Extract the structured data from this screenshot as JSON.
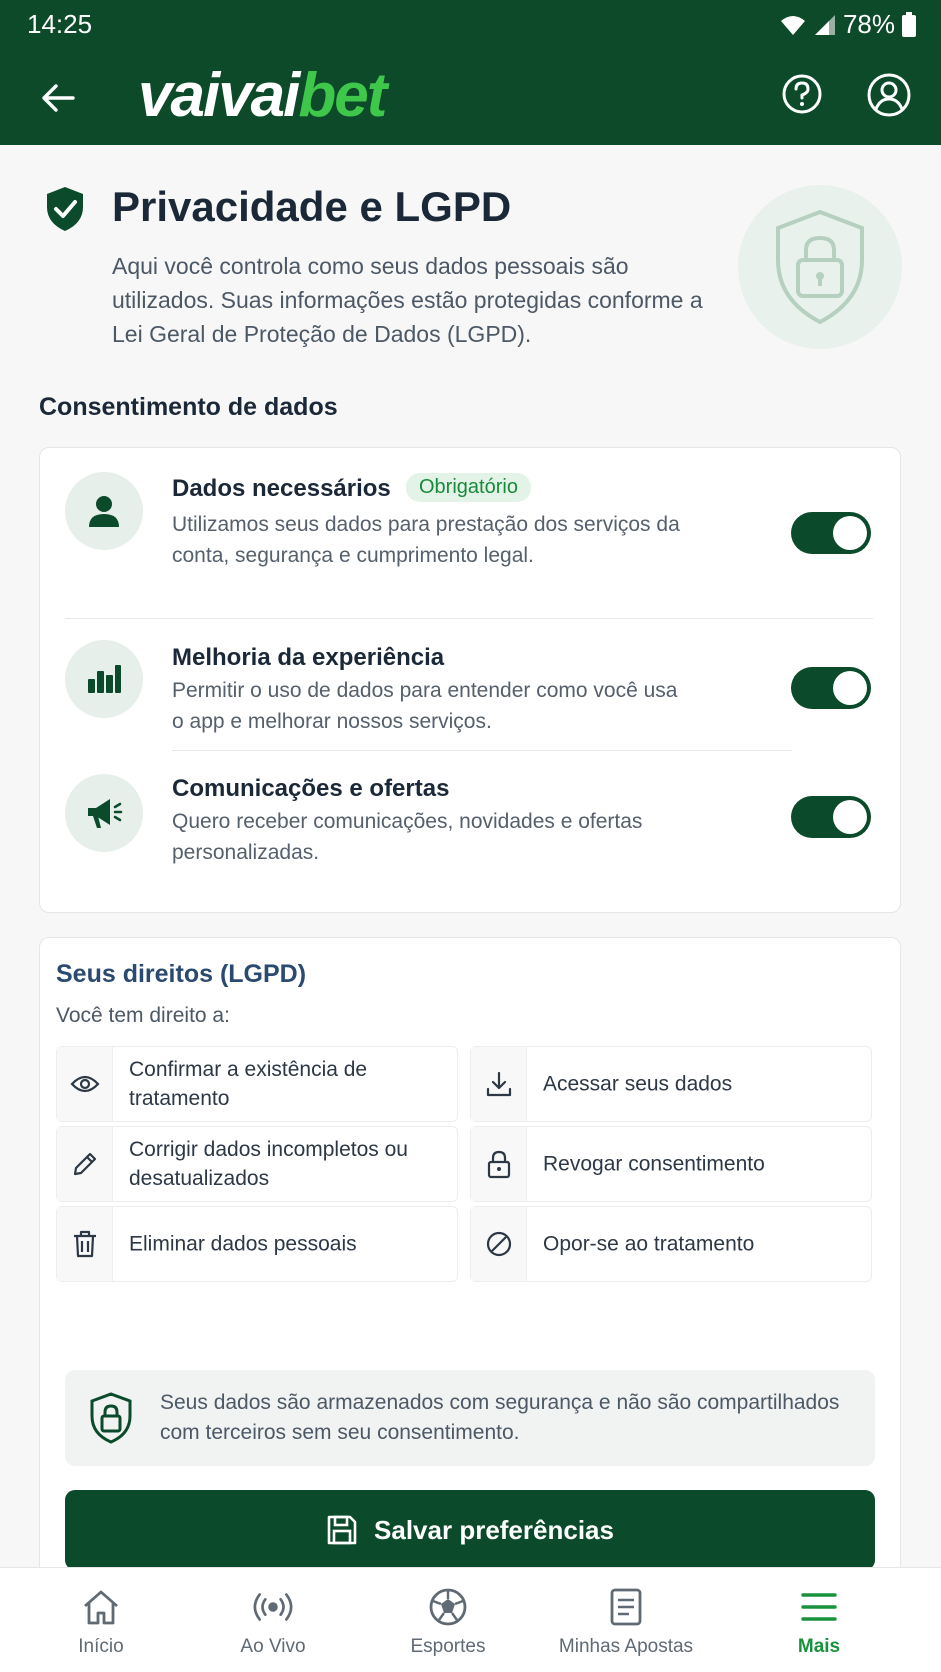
{
  "status_bar": {
    "time": "14:25",
    "battery": "78%"
  },
  "header": {
    "logo_part1": "vaivai",
    "logo_part2": "bet",
    "icons": [
      "arrow-left-icon",
      "help-circle-icon",
      "user-circle-icon"
    ]
  },
  "intro": {
    "title": "Privacidade e LGPD",
    "text": "Aqui você controla como seus dados pessoais são utilizados. Suas informações estão protegidas conforme a Lei Geral de Proteção de Dados (LGPD)."
  },
  "consent": {
    "section_title": "Consentimento de dados",
    "items": [
      {
        "title": "Dados necessários",
        "badge": "Obrigatório",
        "description": "Utilizamos seus dados para prestação dos serviços da conta, segurança e cumprimento legal.",
        "enabled": true,
        "icon": "user-icon"
      },
      {
        "title": "Melhoria da experiência",
        "description": "Permitir o uso de dados para entender como você usa o app e melhorar nossos serviços.",
        "enabled": true,
        "icon": "bar-chart-icon"
      },
      {
        "title": "Comunicações e ofertas",
        "description": "Quero receber comunicações, novidades e ofertas personalizadas.",
        "enabled": true,
        "icon": "megaphone-icon"
      }
    ]
  },
  "rights": {
    "title": "Seus direitos (LGPD)",
    "subtitle": "Você tem direito a:",
    "items": [
      {
        "label": "Confirmar a existência de tratamento",
        "icon": "eye-icon"
      },
      {
        "label": "Acessar seus dados",
        "icon": "download-icon"
      },
      {
        "label": "Corrigir dados incompletos ou desatualizados",
        "icon": "pencil-icon"
      },
      {
        "label": "Revogar consentimento",
        "icon": "lock-icon"
      },
      {
        "label": "Eliminar dados pessoais",
        "icon": "trash-icon"
      },
      {
        "label": "Opor-se ao tratamento",
        "icon": "block-icon"
      }
    ]
  },
  "note": {
    "text": "Seus dados são armazenados com segurança e não são compartilhados com terceiros sem seu consentimento."
  },
  "save_button": {
    "label": "Salvar preferências"
  },
  "bottom_nav": {
    "items": [
      {
        "label": "Início",
        "icon": "home-icon"
      },
      {
        "label": "Ao Vivo",
        "icon": "live-icon"
      },
      {
        "label": "Esportes",
        "icon": "soccer-ball-icon"
      },
      {
        "label": "Minhas Apostas",
        "icon": "document-icon"
      },
      {
        "label": "Mais",
        "icon": "menu-icon",
        "active": true
      }
    ]
  },
  "colors": {
    "brand_dark": "#0b4a2a",
    "brand_green": "#3ec74b",
    "accent": "#19923e"
  }
}
